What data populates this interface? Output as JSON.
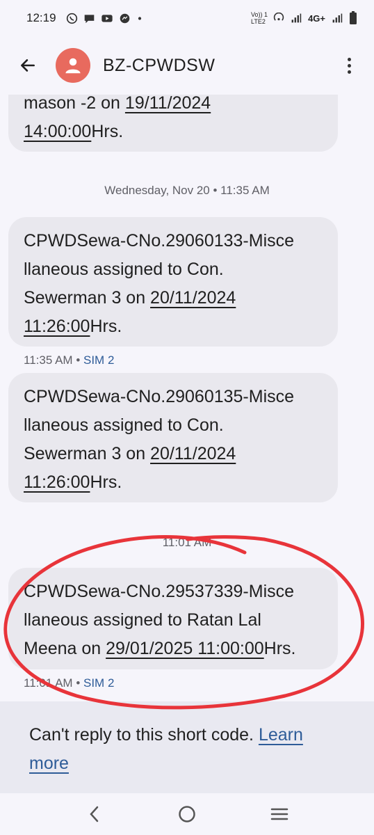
{
  "status_bar": {
    "time": "12:19",
    "network_label_top": "Vo)) 1",
    "network_label_bottom": "LTE2",
    "network_type": "4G+",
    "notification_icons": [
      "whatsapp-icon",
      "chat-icon",
      "youtube-icon",
      "messenger-icon",
      "dot-icon"
    ]
  },
  "app_bar": {
    "title": "BZ-CPWDSW",
    "back_icon": "arrow-left-icon",
    "more_icon": "more-vert-icon"
  },
  "messages": [
    {
      "line1": "mason -2 on ",
      "date_underlined": "19/11/2024",
      "line2_underlined": "14:00:00",
      "line2_rest": "Hrs."
    },
    {
      "line1": "CPWDSewa-CNo.29060133-Misce",
      "line2": "llaneous assigned to Con.",
      "line3": "Sewerman 3 on ",
      "date_underlined": "20/11/2024",
      "line4_underlined": "11:26:00",
      "line4_rest": "Hrs."
    },
    {
      "line1": "CPWDSewa-CNo.29060135-Misce",
      "line2": "llaneous assigned to Con.",
      "line3": "Sewerman 3 on ",
      "date_underlined": "20/11/2024",
      "line4_underlined": "11:26:00",
      "line4_rest": "Hrs."
    },
    {
      "line1": "CPWDSewa-CNo.29537339-Misce",
      "line2": "llaneous assigned to Ratan Lal",
      "line3": "Meena on ",
      "datetime_underlined": "29/01/2025 11:00:00",
      "line3_rest": "Hrs."
    }
  ],
  "day_separators": {
    "first": "Wednesday, Nov 20 • 11:35 AM",
    "second": "11:01 AM"
  },
  "meta": {
    "msg2_time": "11:35 AM",
    "msg4_time": "11:01 AM",
    "separator": "•",
    "sim": "SIM 2"
  },
  "footer": {
    "text": "Can't reply to this short code. ",
    "link": "Learn more"
  },
  "colors": {
    "avatar": "#e86a5e",
    "bubble": "#e9e8ee",
    "link": "#2e5c98",
    "annotation": "#e8343a"
  }
}
